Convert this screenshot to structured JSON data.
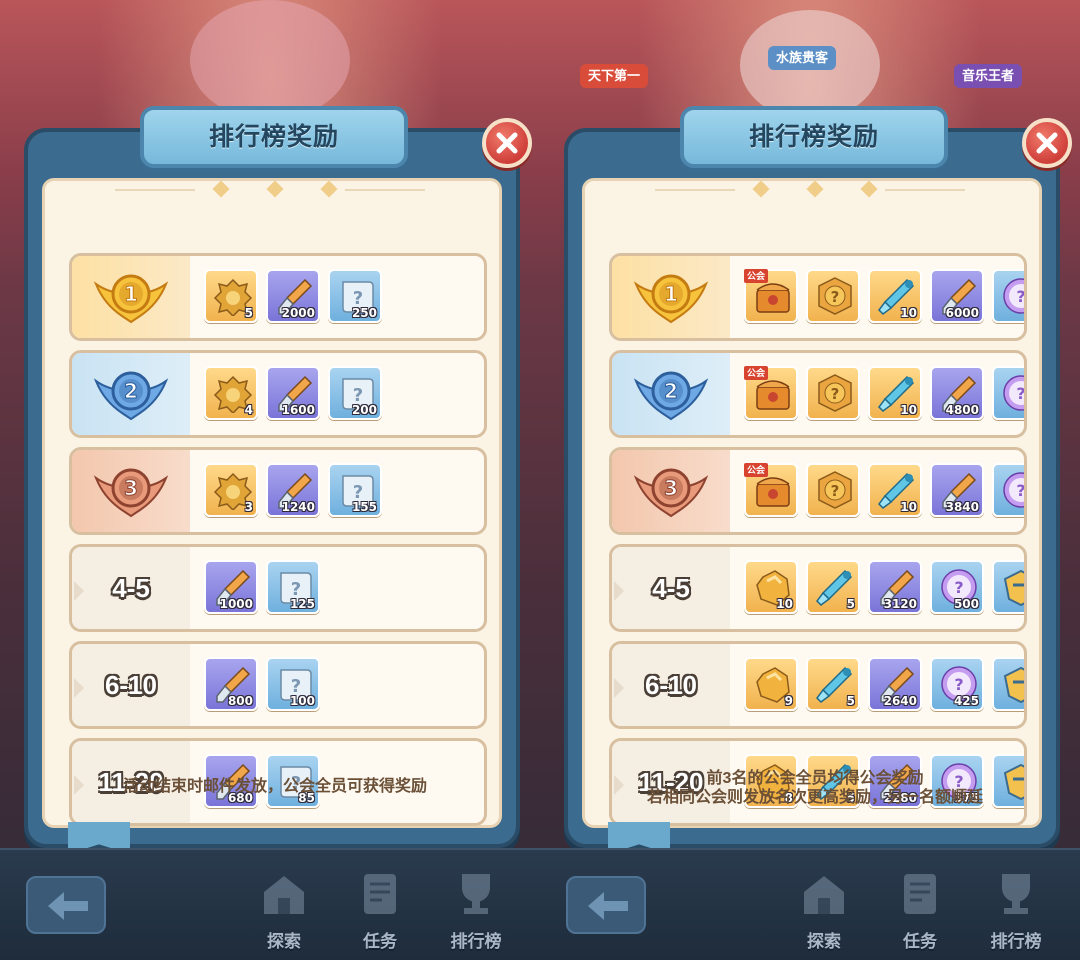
{
  "left_panel": {
    "title": "排行榜奖励",
    "footer": [
      "活动结束时邮件发放，公会全员可获得奖励"
    ],
    "rows": [
      {
        "rank": "1",
        "rank_type": "gold",
        "items": [
          {
            "icon": "lion-emblem-icon",
            "color": "orange",
            "qty": "5"
          },
          {
            "icon": "brush-icon",
            "color": "purple",
            "qty": "2000"
          },
          {
            "icon": "mystery-scroll-icon",
            "color": "blue",
            "qty": "250"
          }
        ]
      },
      {
        "rank": "2",
        "rank_type": "silver",
        "items": [
          {
            "icon": "lion-emblem-icon",
            "color": "orange",
            "qty": "4"
          },
          {
            "icon": "brush-icon",
            "color": "purple",
            "qty": "1600"
          },
          {
            "icon": "mystery-scroll-icon",
            "color": "blue",
            "qty": "200"
          }
        ]
      },
      {
        "rank": "3",
        "rank_type": "bronze",
        "items": [
          {
            "icon": "lion-emblem-icon",
            "color": "orange",
            "qty": "3"
          },
          {
            "icon": "brush-icon",
            "color": "purple",
            "qty": "1240"
          },
          {
            "icon": "mystery-scroll-icon",
            "color": "blue",
            "qty": "155"
          }
        ]
      },
      {
        "rank": "4-5",
        "rank_type": "plain",
        "items": [
          {
            "icon": "brush-icon",
            "color": "purple",
            "qty": "1000"
          },
          {
            "icon": "mystery-scroll-icon",
            "color": "blue",
            "qty": "125"
          }
        ]
      },
      {
        "rank": "6-10",
        "rank_type": "plain",
        "items": [
          {
            "icon": "brush-icon",
            "color": "purple",
            "qty": "800"
          },
          {
            "icon": "mystery-scroll-icon",
            "color": "blue",
            "qty": "100"
          }
        ]
      },
      {
        "rank": "11-20",
        "rank_type": "plain",
        "items": [
          {
            "icon": "brush-icon",
            "color": "purple",
            "qty": "680"
          },
          {
            "icon": "mystery-scroll-icon",
            "color": "blue",
            "qty": "85"
          }
        ]
      }
    ]
  },
  "right_panel": {
    "title": "排行榜奖励",
    "footer": [
      "前3名的公会全员均得公会奖励",
      "若相同公会则发放名次更高奖励，另一名额顺延"
    ],
    "top_badges": [
      "天下第一",
      "水族贵客",
      "音乐王者"
    ],
    "rows": [
      {
        "rank": "1",
        "rank_type": "gold",
        "items": [
          {
            "icon": "guild-chest-icon",
            "color": "orange",
            "qty": "",
            "tag": "公会"
          },
          {
            "icon": "mystery-coin-icon",
            "color": "orange",
            "qty": ""
          },
          {
            "icon": "crystal-wand-icon",
            "color": "orange",
            "qty": "10"
          },
          {
            "icon": "brush-icon",
            "color": "purple",
            "qty": "6000"
          },
          {
            "icon": "mystery-orb-icon",
            "color": "blue",
            "qty": ""
          }
        ]
      },
      {
        "rank": "2",
        "rank_type": "silver",
        "items": [
          {
            "icon": "guild-chest-icon",
            "color": "orange",
            "qty": "",
            "tag": "公会"
          },
          {
            "icon": "mystery-coin-icon",
            "color": "orange",
            "qty": ""
          },
          {
            "icon": "crystal-wand-icon",
            "color": "orange",
            "qty": "10"
          },
          {
            "icon": "brush-icon",
            "color": "purple",
            "qty": "4800"
          },
          {
            "icon": "mystery-orb-icon",
            "color": "blue",
            "qty": ""
          }
        ]
      },
      {
        "rank": "3",
        "rank_type": "bronze",
        "items": [
          {
            "icon": "guild-chest-icon",
            "color": "orange",
            "qty": "",
            "tag": "公会"
          },
          {
            "icon": "mystery-coin-icon",
            "color": "orange",
            "qty": ""
          },
          {
            "icon": "crystal-wand-icon",
            "color": "orange",
            "qty": "10"
          },
          {
            "icon": "brush-icon",
            "color": "purple",
            "qty": "3840"
          },
          {
            "icon": "mystery-orb-icon",
            "color": "blue",
            "qty": ""
          }
        ]
      },
      {
        "rank": "4-5",
        "rank_type": "plain",
        "items": [
          {
            "icon": "gold-ore-icon",
            "color": "orange",
            "qty": "10"
          },
          {
            "icon": "crystal-wand-icon",
            "color": "orange",
            "qty": "5"
          },
          {
            "icon": "brush-icon",
            "color": "purple",
            "qty": "3120"
          },
          {
            "icon": "mystery-orb-icon",
            "color": "blue",
            "qty": "500"
          },
          {
            "icon": "badge-icon",
            "color": "blue",
            "qty": ""
          }
        ]
      },
      {
        "rank": "6-10",
        "rank_type": "plain",
        "items": [
          {
            "icon": "gold-ore-icon",
            "color": "orange",
            "qty": "9"
          },
          {
            "icon": "crystal-wand-icon",
            "color": "orange",
            "qty": "5"
          },
          {
            "icon": "brush-icon",
            "color": "purple",
            "qty": "2640"
          },
          {
            "icon": "mystery-orb-icon",
            "color": "blue",
            "qty": "425"
          },
          {
            "icon": "badge-icon",
            "color": "blue",
            "qty": ""
          }
        ]
      },
      {
        "rank": "11-20",
        "rank_type": "plain",
        "items": [
          {
            "icon": "gold-ore-icon",
            "color": "orange",
            "qty": "8"
          },
          {
            "icon": "crystal-wand-icon",
            "color": "orange",
            "qty": "5"
          },
          {
            "icon": "brush-icon",
            "color": "purple",
            "qty": "2280"
          },
          {
            "icon": "mystery-orb-icon",
            "color": "blue",
            "qty": "375"
          },
          {
            "icon": "badge-icon",
            "color": "blue",
            "qty": ""
          }
        ]
      }
    ]
  },
  "nav": {
    "back_icon": "back-arrow-icon",
    "items": [
      {
        "label": "探索",
        "icon": "explore-icon"
      },
      {
        "label": "任务",
        "icon": "task-icon"
      },
      {
        "label": "排行榜",
        "icon": "trophy-icon"
      }
    ]
  },
  "colors": {
    "panel_frame": "#3b6b8f",
    "panel_inner": "#fbf3e4",
    "gold_row": "#fde0a3",
    "silver_row": "#c9e3f3",
    "bronze_row": "#f3c7ad",
    "close_button": "#cf3f3a"
  }
}
